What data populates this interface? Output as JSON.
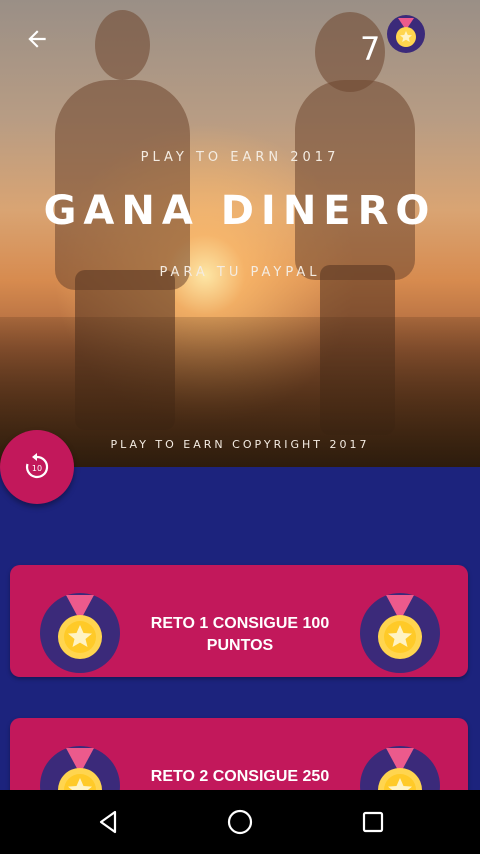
{
  "hero": {
    "tagline": "PLAY TO EARN 2017",
    "title": "GANA DINERO",
    "subtitle": "PARA TU PAYPAL",
    "copyright": "PLAY TO EARN COPYRIGHT 2017"
  },
  "header": {
    "coin_count": "7",
    "back_icon": "arrow-back-icon",
    "coin_icon": "medal-icon"
  },
  "replay_button": {
    "icon": "replay-10-icon",
    "label": "10"
  },
  "challenges": [
    {
      "label": "RETO 1  CONSIGUE 100 PUNTOS",
      "icon": "medal-icon"
    },
    {
      "label": "RETO 2  CONSIGUE 250",
      "icon": "medal-icon"
    }
  ],
  "navbar": {
    "back_icon": "nav-back-icon",
    "home_icon": "nav-home-icon",
    "recents_icon": "nav-recents-icon"
  },
  "colors": {
    "background": "#1c237d",
    "accent": "#c2185b",
    "medal_ring": "#3b2a7a",
    "medal_gold": "#ffd54f",
    "ribbon": "#ec5a8c"
  }
}
